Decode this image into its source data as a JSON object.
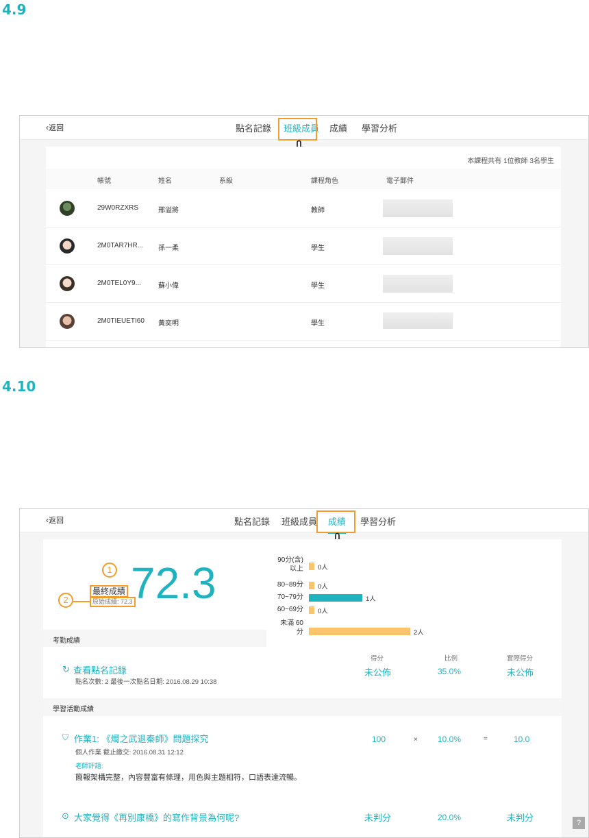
{
  "section1": {
    "number": "4.9"
  },
  "section2": {
    "number": "4.10"
  },
  "nav": {
    "back": "返回",
    "attendance": "點名記錄",
    "members": "班級成員",
    "grades": "成績",
    "analysis": "學習分析"
  },
  "members": {
    "summary": "本課程共有 1位教師 3名學生",
    "columns": {
      "account": "帳號",
      "name": "姓名",
      "dept": "系級",
      "role": "課程角色",
      "email": "電子郵件"
    },
    "rows": [
      {
        "account": "29W0RZXRS",
        "name": "邢溢將",
        "role": "教師"
      },
      {
        "account": "2M0TAR7HR...",
        "name": "孫一柔",
        "role": "學生"
      },
      {
        "account": "2M0TEL0Y9...",
        "name": "蘇小偉",
        "role": "學生"
      },
      {
        "account": "2M0TIEUETI60",
        "name": "黃奕明",
        "role": "學生"
      }
    ]
  },
  "grades": {
    "final_label": "最終成績",
    "final_score": "72.3",
    "original": "原始成績: 72.3",
    "marker1": "1",
    "marker2": "2",
    "distribution": [
      {
        "label": "90分(含)以上",
        "count": 0,
        "count_label": "0人"
      },
      {
        "label": "80~89分",
        "count": 0,
        "count_label": "0人"
      },
      {
        "label": "70~79分",
        "count": 1,
        "count_label": "1人"
      },
      {
        "label": "60~69分",
        "count": 0,
        "count_label": "0人"
      },
      {
        "label": "未滿 60 分",
        "count": 2,
        "count_label": "2人"
      }
    ],
    "attendance_section": "考勤成績",
    "col_score": "得分",
    "col_ratio": "比例",
    "col_actual": "實際得分",
    "attendance_link": "查看點名記錄",
    "attendance_meta": "點名次數:  2    最後一次點名日期:  2016.08.29 10:38",
    "attendance_score": "未公佈",
    "attendance_ratio": "35.0%",
    "attendance_actual": "未公佈",
    "activity_section": "學習活動成績",
    "hw_title": "作業1: 《燭之武退秦師》問題探究",
    "hw_meta": "個人作業    截止繳交:  2016.08.31 12:12",
    "teacher_comment_label": "老師評語:",
    "teacher_comment": "簡報架構完整，內容豐富有條理，用色與主題相符，口語表達流暢。",
    "hw_score": "100",
    "times": "×",
    "hw_ratio": "10.0%",
    "equals": "=",
    "hw_actual": "10.0",
    "discussion_title": "大家覺得《再別康橋》的寫作背景為何呢?",
    "discussion_score": "未判分",
    "discussion_ratio": "20.0%",
    "discussion_actual": "未判分"
  },
  "colors": {
    "accent": "#1fb3c0",
    "highlight": "#f39c29",
    "bar_alt": "#fdc46b"
  }
}
